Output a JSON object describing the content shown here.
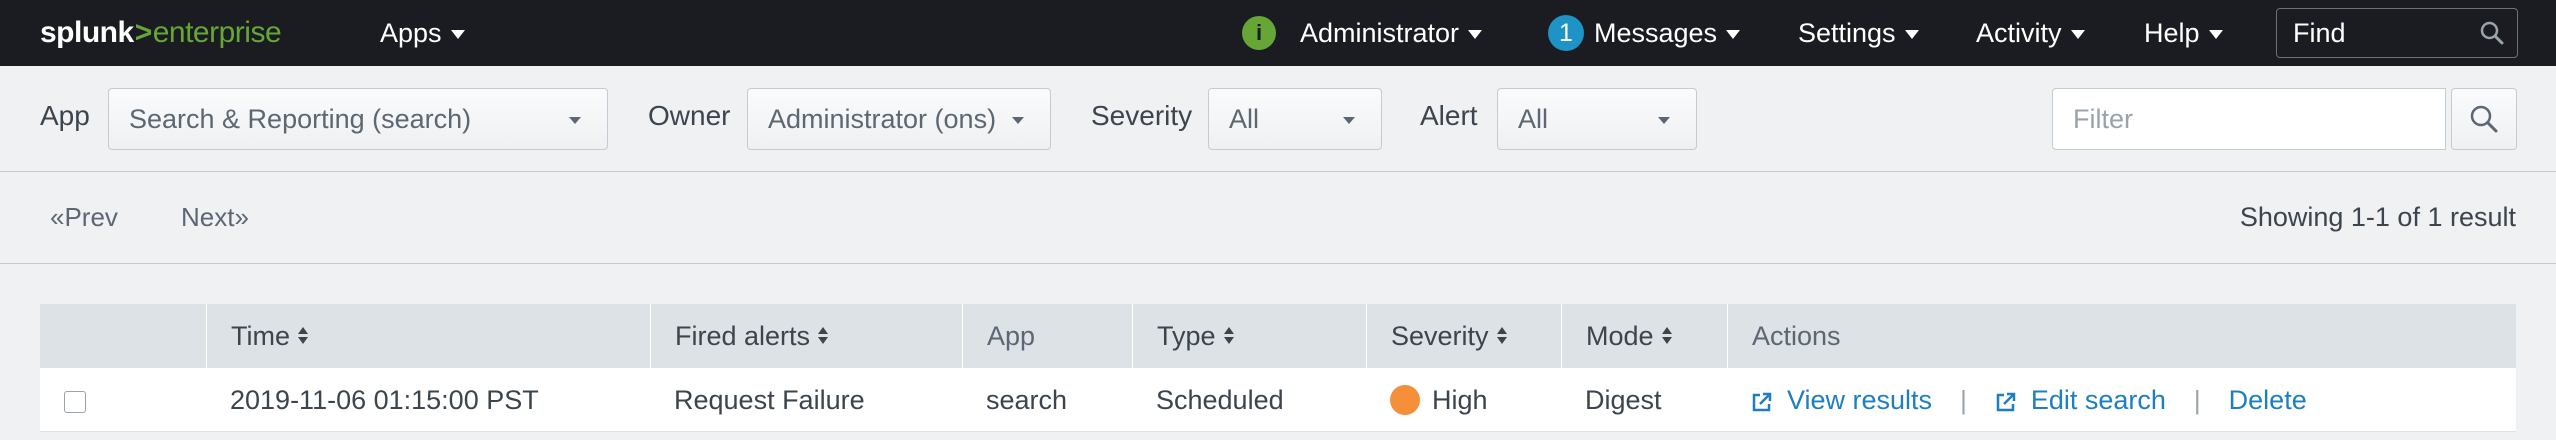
{
  "app_header": {
    "logo": {
      "part1": "splunk",
      "part2": ">",
      "part3": "enterprise"
    },
    "nav": {
      "apps": "Apps",
      "user": "Administrator",
      "messages_count": "1",
      "messages": "Messages",
      "settings": "Settings",
      "activity": "Activity",
      "help": "Help"
    },
    "find_placeholder": "Find"
  },
  "filters": {
    "app_label": "App",
    "app_value": "Search & Reporting (search)",
    "owner_label": "Owner",
    "owner_value": "Administrator (ons)",
    "severity_label": "Severity",
    "severity_value": "All",
    "alert_label": "Alert",
    "alert_value": "All",
    "filter_placeholder": "Filter"
  },
  "pagination": {
    "prev": "«Prev",
    "next": "Next»",
    "showing": "Showing 1-1 of 1 result"
  },
  "table": {
    "columns": {
      "time": "Time",
      "fired_alerts": "Fired alerts",
      "app": "App",
      "type": "Type",
      "severity": "Severity",
      "mode": "Mode",
      "actions": "Actions"
    },
    "rows": [
      {
        "time": "2019-11-06 01:15:00 PST",
        "fired_alert": "Request Failure",
        "app": "search",
        "type": "Scheduled",
        "severity": "High",
        "mode": "Digest",
        "view_results": "View results",
        "edit_search": "Edit search",
        "delete": "Delete"
      }
    ]
  },
  "colors": {
    "navbar_bg": "#1a1c21",
    "brand_green": "#65a637",
    "badge_blue": "#1e93c6",
    "link_blue": "#1e7fc0",
    "severity_high": "#f58f39"
  },
  "separator": "|"
}
